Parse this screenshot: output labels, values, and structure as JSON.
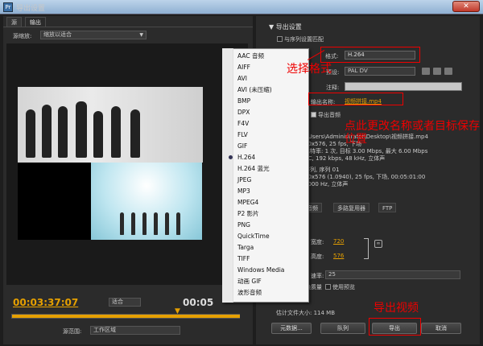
{
  "window": {
    "title": "导出设置",
    "close_label": "✕"
  },
  "left": {
    "tabs": [
      "源",
      "输出"
    ],
    "scale_label": "源缩放:",
    "scale_value": "缩放以适合",
    "timecode": "00:03:37:07",
    "fit_value": "适合",
    "timecode_right": "00:05",
    "range_label": "源范围:",
    "range_value": "工作区域"
  },
  "right": {
    "header": "导出设置",
    "match_sequence": "与序列设置匹配",
    "format_label": "格式:",
    "format_value": "H.264",
    "preset_label": "预设:",
    "preset_value": "PAL DV",
    "comment_label": "注释:",
    "output_name_label": "输出名称:",
    "output_name_value": "视频拼接.mp4",
    "export_audio": "导出音频",
    "summary_lines": [
      ":\\Users\\Administrator\\Desktop\\视频拼接.mp4",
      "20x576, 25 fps, 下场",
      "比特率: 1 次, 目标 3.00 Mbps, 最大 6.00 Mbps",
      "AC, 192 kbps, 48 kHz, 立体声",
      "",
      "序列, 序列 01",
      "20x576 (1.0940), 25 fps, 下场, 00:05:01:00",
      "8000 Hz, 立体声"
    ],
    "subtabs": [
      "音频",
      "多路复用器",
      "FTP"
    ],
    "settings_label": "设置",
    "width_label": "宽度:",
    "width_value": "720",
    "height_label": "高度:",
    "height_value": "576",
    "field_rate_label": "速率:",
    "field_rate_value": "25",
    "max_quality": "染质量",
    "use_preview": "使用预览",
    "file_size": "估计文件大小: 114 MB",
    "buttons": {
      "metadata": "元数据...",
      "queue": "队列",
      "export": "导出",
      "cancel": "取消"
    }
  },
  "dropdown": {
    "items": [
      "AAC 音频",
      "AIFF",
      "AVI",
      "AVI (未压缩)",
      "BMP",
      "DPX",
      "F4V",
      "FLV",
      "GIF",
      "H.264",
      "H.264 蓝光",
      "JPEG",
      "MP3",
      "MPEG4",
      "P2 影片",
      "PNG",
      "QuickTime",
      "Targa",
      "TIFF",
      "Windows Media",
      "动画 GIF",
      "波形音频"
    ],
    "selected": "H.264"
  },
  "annotations": {
    "format": "选择格式",
    "name": "点此更改名称或者目标保存位置",
    "export": "导出视频",
    "color": "#ee0000"
  },
  "colors": {
    "accent": "#e6a000",
    "panel": "#2b2b2b"
  }
}
